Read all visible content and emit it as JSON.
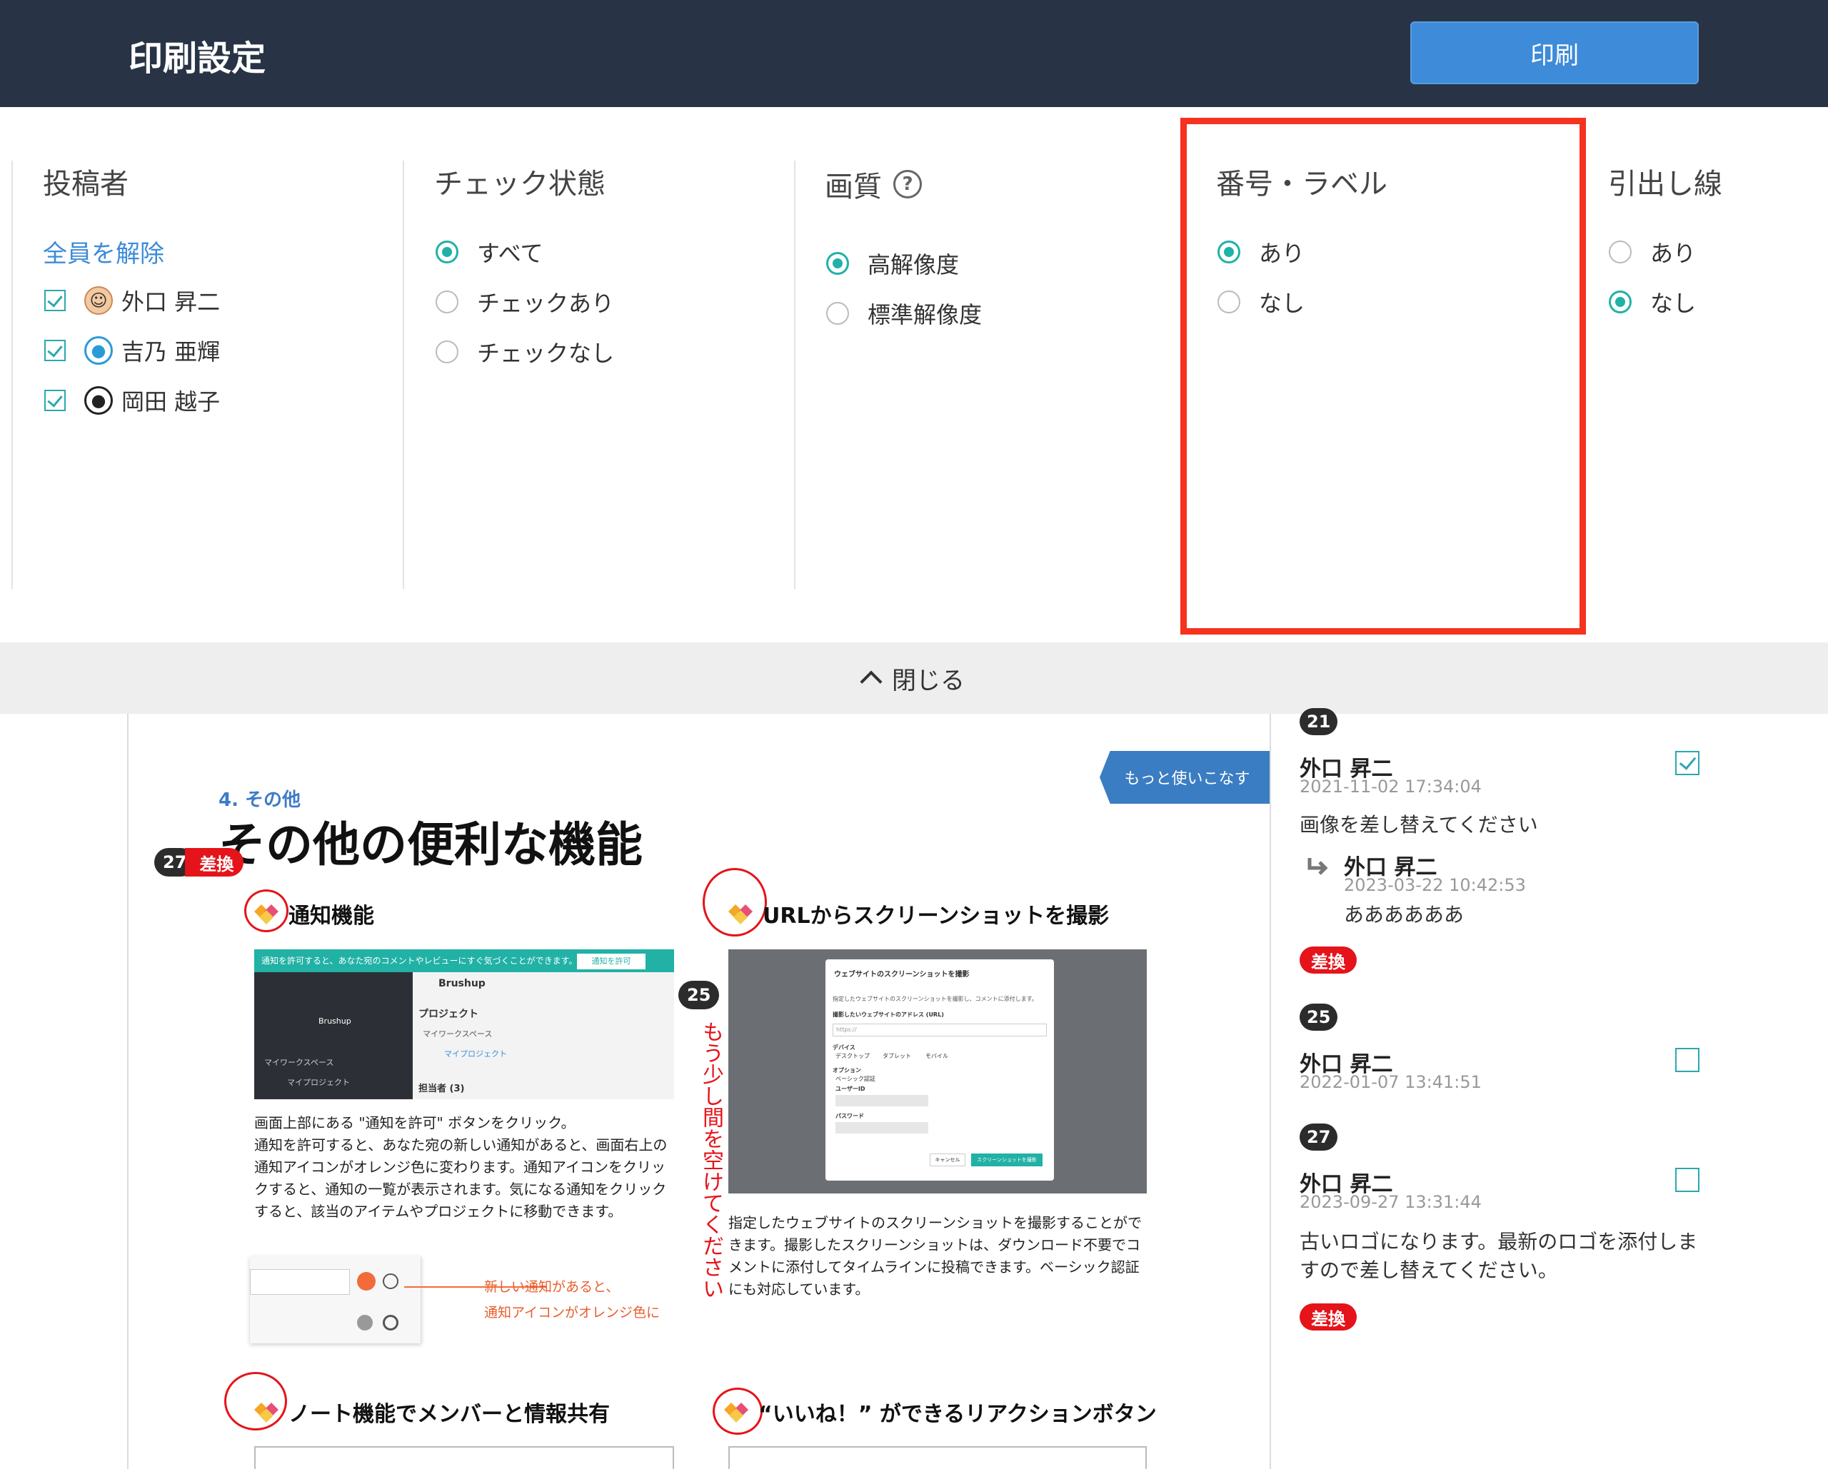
{
  "header": {
    "title": "印刷設定",
    "print_label": "印刷"
  },
  "settings": {
    "poster": {
      "title": "投稿者",
      "clear_all": "全員を解除",
      "users": [
        {
          "name": "外口 昇二",
          "checked": true,
          "avatar": "photo-avatar"
        },
        {
          "name": "吉乃 亜輝",
          "checked": true,
          "avatar": "user-icon-blue"
        },
        {
          "name": "岡田 越子",
          "checked": true,
          "avatar": "user-icon-dark"
        }
      ]
    },
    "check_state": {
      "title": "チェック状態",
      "options": [
        {
          "label": "すべて",
          "selected": true
        },
        {
          "label": "チェックあり",
          "selected": false
        },
        {
          "label": "チェックなし",
          "selected": false
        }
      ]
    },
    "quality": {
      "title": "画質",
      "options": [
        {
          "label": "高解像度",
          "selected": true
        },
        {
          "label": "標準解像度",
          "selected": false
        }
      ]
    },
    "number_label": {
      "title": "番号・ラベル",
      "options": [
        {
          "label": "あり",
          "selected": true
        },
        {
          "label": "なし",
          "selected": false
        }
      ]
    },
    "leader_line": {
      "title": "引出し線",
      "options": [
        {
          "label": "あり",
          "selected": false
        },
        {
          "label": "なし",
          "selected": true
        }
      ]
    },
    "close_label": "閉じる"
  },
  "document": {
    "section_label": "4. その他",
    "title": "その他の便利な機能",
    "corner_tag": "もっと使いこなす",
    "pin27": {
      "number": "27",
      "tag": "差換"
    },
    "pin25": {
      "number": "25"
    },
    "vertical_note": "もう少し間を空けてください",
    "features": {
      "notify": {
        "title": "通知機能",
        "body": "画面上部にある \"通知を許可\" ボタンをクリック。\n通知を許可すると、あなた宛の新しい通知があると、画面右上の通知アイコンがオレンジ色に変わります。通知アイコンをクリックすると、通知の一覧が表示されます。気になる通知をクリックすると、該当のアイテムやプロジェクトに移動できます。",
        "shot_banner": "通知を許可すると、あなた宛のコメントやレビューにすぐ気づくことができます。",
        "shot_button": "通知を許可",
        "shot_brand": "Brushup",
        "shot_project": "プロジェクト",
        "shot_workspace": "マイワークスペース",
        "shot_myproject": "マイプロジェクト",
        "shot_assignee": "担当者 (3)",
        "callout_line1": "新しい通知があると、",
        "callout_line2": "通知アイコンがオレンジ色に"
      },
      "url_shot": {
        "title": "URLからスクリーンショットを撮影",
        "body": "指定したウェブサイトのスクリーンショットを撮影することができます。撮影したスクリーンショットは、ダウンロード不要でコメントに添付してタイムラインに投稿できます。ベーシック認証にも対応しています。",
        "dialog_title": "ウェブサイトのスクリーンショットを撮影",
        "dialog_desc": "指定したウェブサイトのスクリーンショットを撮影し、コメントに添付します。",
        "dialog_url_label": "撮影したいウェブサイトのアドレス (URL)",
        "dialog_url_placeholder": "https://",
        "dialog_device_label": "デバイス",
        "dialog_devices": [
          "デスクトップ",
          "タブレット",
          "モバイル"
        ],
        "dialog_option_label": "オプション",
        "dialog_basic": "ベーシック認証",
        "dialog_user": "ユーザーID",
        "dialog_pass": "パスワード",
        "dialog_cancel": "キャンセル",
        "dialog_submit": "スクリーンショットを撮影"
      },
      "note": {
        "title": "ノート機能でメンバーと情報共有"
      },
      "reaction": {
        "title": "“いいね！” ができるリアクションボタン"
      }
    }
  },
  "comments": [
    {
      "number": "21",
      "author": "外口 昇二",
      "date": "2021-11-02 17:34:04",
      "text": "画像を差し替えてください",
      "checked": true,
      "reply": {
        "author": "外口 昇二",
        "date": "2023-03-22 10:42:53",
        "text": "ああああああ"
      },
      "tag": "差換"
    },
    {
      "number": "25",
      "author": "外口 昇二",
      "date": "2022-01-07 13:41:51",
      "checked": false
    },
    {
      "number": "27",
      "author": "外口 昇二",
      "date": "2023-09-27 13:31:44",
      "text": "古いロゴになります。最新のロゴを添付しますので差し替えてください。",
      "checked": false,
      "tag": "差換"
    }
  ],
  "colors": {
    "header_bg": "#283445",
    "primary": "#3d8bd9",
    "teal": "#20b2a8",
    "highlight": "#f5331f",
    "tag_red": "#e4141a"
  }
}
